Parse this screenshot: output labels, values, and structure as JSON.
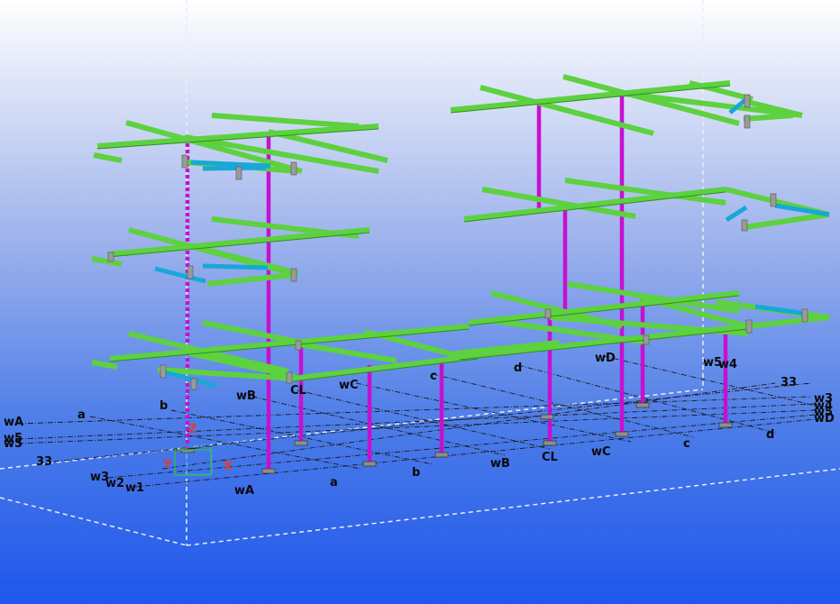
{
  "colors": {
    "beam": "#5dd13f",
    "beam_edge": "#2f8f1c",
    "column": "#c80fd0",
    "brace": "#17a8d8",
    "plate": "#9a9a9a",
    "grid_line": "#1b1b1b",
    "axis_x": "#e23c2a",
    "axis_y": "#e23c2a",
    "axis_z": "#e23c2a"
  },
  "grid_labels": {
    "near_wA": "wA",
    "near_w5": "w5",
    "near_w3": "w3",
    "near_w2": "w2",
    "near_w1": "w1",
    "near_33": "33",
    "near_a": "a",
    "near_b": "b",
    "near_wB": "wB",
    "near_CL": "CL",
    "near_wC": "wC",
    "near_c": "c",
    "near_d": "d",
    "near_wD": "wD",
    "far_wA": "wA",
    "far_a": "a",
    "far_b": "b",
    "far_wB": "wB",
    "far_CL": "CL",
    "far_wC": "wC",
    "far_c": "c",
    "far_d": "d",
    "right_33": "33",
    "right_w3": "w3",
    "right_w4": "w4",
    "right_w5": "w5",
    "right_wD": "wD",
    "top_w5": "w5",
    "top_w4": "w4"
  },
  "axes": {
    "x": "X",
    "y": "Y",
    "z": "Z"
  }
}
